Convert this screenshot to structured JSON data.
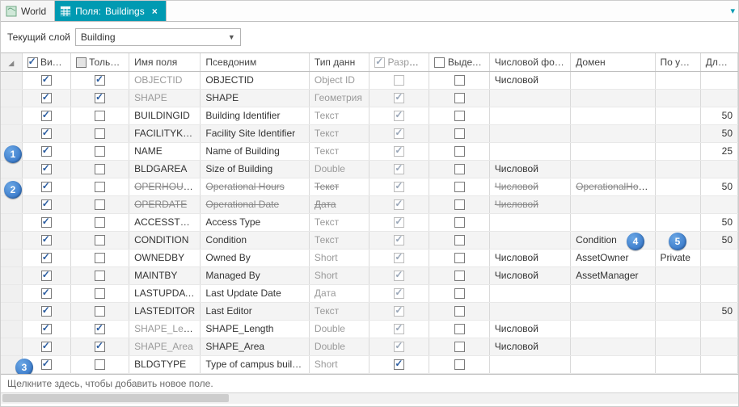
{
  "tabs": {
    "world": "World",
    "fields_prefix": "Поля:",
    "fields_name": "Buildings"
  },
  "toolbar": {
    "current_layer_label": "Текущий слой",
    "current_layer_value": "Building"
  },
  "headers": {
    "visible": "Видим",
    "readonly": "Только чт",
    "fieldname": "Имя поля",
    "alias": "Псевдоним",
    "datatype": "Тип данн",
    "allow": "Разрешить",
    "highlight": "Выделить",
    "numfmt": "Числовой форм",
    "domain": "Домен",
    "default": "По умол",
    "length": "Длина"
  },
  "rows": [
    {
      "vis": true,
      "ro": true,
      "name": "OBJECTID",
      "alias": "OBJECTID",
      "type": "Object ID",
      "allow": false,
      "allow_dis": true,
      "hl": false,
      "numfmt": "Числовой",
      "domain": "",
      "def": "",
      "len": "",
      "name_gray": true,
      "type_gray": true
    },
    {
      "vis": true,
      "ro": true,
      "name": "SHAPE",
      "alias": "SHAPE",
      "type": "Геометрия",
      "allow": true,
      "allow_dis": true,
      "hl": false,
      "numfmt": "",
      "domain": "",
      "def": "",
      "len": "",
      "name_gray": true,
      "type_gray": true
    },
    {
      "vis": true,
      "ro": false,
      "name": "BUILDINGID",
      "alias": "Building Identifier",
      "type": "Текст",
      "allow": true,
      "allow_dis": true,
      "hl": false,
      "numfmt": "",
      "domain": "",
      "def": "",
      "len": "50",
      "type_gray": true
    },
    {
      "vis": true,
      "ro": false,
      "name": "FACILITYKEY",
      "alias": "Facility Site Identifier",
      "type": "Текст",
      "allow": true,
      "allow_dis": true,
      "hl": false,
      "numfmt": "",
      "domain": "",
      "def": "",
      "len": "50",
      "type_gray": true
    },
    {
      "vis": true,
      "ro": false,
      "name": "NAME",
      "alias": "Name of Building",
      "type": "Текст",
      "allow": true,
      "allow_dis": true,
      "hl": false,
      "numfmt": "",
      "domain": "",
      "def": "",
      "len": "25",
      "type_gray": true
    },
    {
      "vis": true,
      "ro": false,
      "name": "BLDGAREA",
      "alias": "Size of Building",
      "type": "Double",
      "allow": true,
      "allow_dis": true,
      "hl": false,
      "numfmt": "Числовой",
      "domain": "",
      "def": "",
      "len": "",
      "type_gray": true
    },
    {
      "vis": true,
      "ro": false,
      "name": "OPERHOURS",
      "alias": "Operational Hours",
      "type": "Текст",
      "allow": true,
      "allow_dis": true,
      "hl": false,
      "numfmt": "Числовой",
      "domain": "OperationalHours",
      "def": "",
      "len": "50",
      "strike": true,
      "type_gray": true
    },
    {
      "vis": true,
      "ro": false,
      "name": "OPERDATE",
      "alias": "Operational Date",
      "type": "Дата",
      "allow": true,
      "allow_dis": true,
      "hl": false,
      "numfmt": "Числовой",
      "domain": "",
      "def": "",
      "len": "",
      "strike": true,
      "type_gray": true
    },
    {
      "vis": true,
      "ro": false,
      "name": "ACCESSTYPE",
      "alias": "Access Type",
      "type": "Текст",
      "allow": true,
      "allow_dis": true,
      "hl": false,
      "numfmt": "",
      "domain": "",
      "def": "",
      "len": "50",
      "type_gray": true
    },
    {
      "vis": true,
      "ro": false,
      "name": "CONDITION",
      "alias": "Condition",
      "type": "Текст",
      "allow": true,
      "allow_dis": true,
      "hl": false,
      "numfmt": "",
      "domain": "Condition",
      "def": "",
      "len": "50",
      "type_gray": true
    },
    {
      "vis": true,
      "ro": false,
      "name": "OWNEDBY",
      "alias": "Owned By",
      "type": "Short",
      "allow": true,
      "allow_dis": true,
      "hl": false,
      "numfmt": "Числовой",
      "domain": "AssetOwner",
      "def": "Private",
      "len": "",
      "type_gray": true
    },
    {
      "vis": true,
      "ro": false,
      "name": "MAINTBY",
      "alias": "Managed By",
      "type": "Short",
      "allow": true,
      "allow_dis": true,
      "hl": false,
      "numfmt": "Числовой",
      "domain": "AssetManager",
      "def": "",
      "len": "",
      "type_gray": true
    },
    {
      "vis": true,
      "ro": false,
      "name": "LASTUPDATE",
      "alias": "Last Update Date",
      "type": "Дата",
      "allow": true,
      "allow_dis": true,
      "hl": false,
      "numfmt": "",
      "domain": "",
      "def": "",
      "len": "",
      "type_gray": true
    },
    {
      "vis": true,
      "ro": false,
      "name": "LASTEDITOR",
      "alias": "Last Editor",
      "type": "Текст",
      "allow": true,
      "allow_dis": true,
      "hl": false,
      "numfmt": "",
      "domain": "",
      "def": "",
      "len": "50",
      "type_gray": true
    },
    {
      "vis": true,
      "ro": true,
      "name": "SHAPE_Length",
      "alias": "SHAPE_Length",
      "type": "Double",
      "allow": true,
      "allow_dis": true,
      "hl": false,
      "numfmt": "Числовой",
      "domain": "",
      "def": "",
      "len": "",
      "name_gray": true,
      "type_gray": true
    },
    {
      "vis": true,
      "ro": true,
      "name": "SHAPE_Area",
      "alias": "SHAPE_Area",
      "type": "Double",
      "allow": true,
      "allow_dis": true,
      "hl": false,
      "numfmt": "Числовой",
      "domain": "",
      "def": "",
      "len": "",
      "name_gray": true,
      "type_gray": true
    },
    {
      "vis": true,
      "ro": false,
      "name": "BLDGTYPE",
      "alias": "Type of campus building",
      "type": "Short",
      "allow": true,
      "allow_dis": false,
      "hl": false,
      "numfmt": "",
      "domain": "",
      "def": "",
      "len": "",
      "type_gray": true
    }
  ],
  "footer": {
    "add_new_hint": "Щелкните здесь, чтобы добавить новое поле."
  },
  "callouts": {
    "c1": "1",
    "c2": "2",
    "c3": "3",
    "c4": "4",
    "c5": "5"
  }
}
